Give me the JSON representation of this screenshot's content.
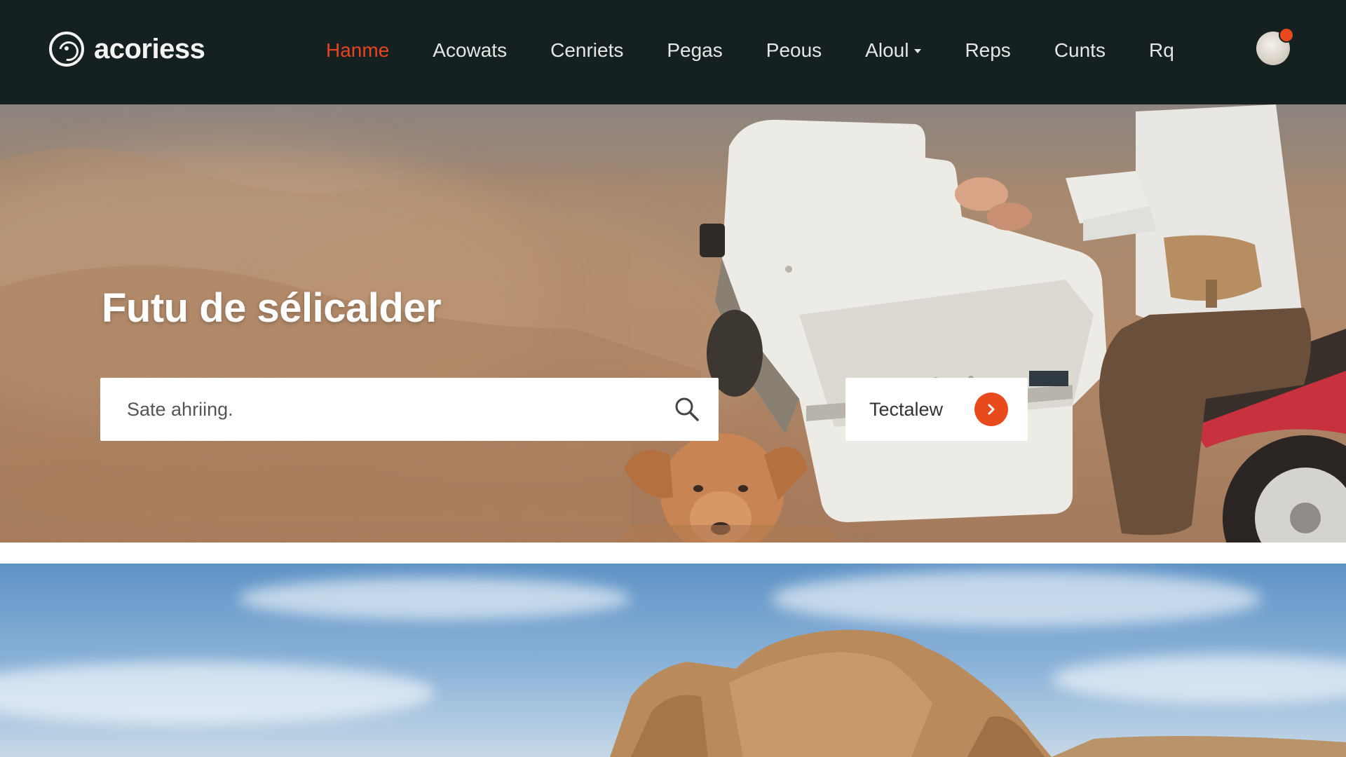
{
  "brand": {
    "name": "acoriess",
    "logo_icon": "circle-logo-icon"
  },
  "nav": {
    "active_color": "#e8441f",
    "items": [
      {
        "label": "Hanme",
        "active": true
      },
      {
        "label": "Acowats",
        "active": false
      },
      {
        "label": "Cenriets",
        "active": false
      },
      {
        "label": "Pegas",
        "active": false
      },
      {
        "label": "Peous",
        "active": false
      },
      {
        "label": "Aloul",
        "active": false,
        "dropdown": true
      },
      {
        "label": "Reps",
        "active": false
      },
      {
        "label": "Cunts",
        "active": false
      },
      {
        "label": "Rq",
        "active": false
      }
    ]
  },
  "user": {
    "avatar_icon": "user-avatar-icon",
    "notification_color": "#e84a1e"
  },
  "hero": {
    "title": "Futu de sélicalder",
    "search": {
      "placeholder": "Sate ahriing.",
      "icon": "search-icon"
    },
    "cta": {
      "label": "Tectalew",
      "icon": "chevron-right-icon",
      "accent": "#e84a1e"
    }
  },
  "colors": {
    "navbar_bg": "#152021",
    "nav_text": "#e6e6e6",
    "accent": "#e84a1e"
  }
}
